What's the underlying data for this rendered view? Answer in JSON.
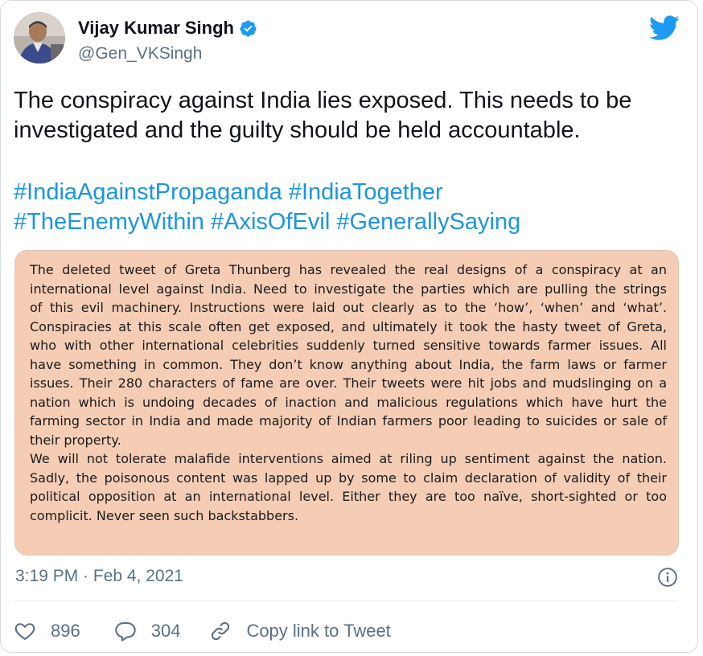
{
  "author": {
    "name": "Vijay Kumar Singh",
    "handle": "@Gen_VKSingh",
    "verified": true
  },
  "tweet": {
    "text_lines": [
      "The conspiracy against India lies exposed. This needs to be",
      "investigated and the guilty should be held accountable."
    ],
    "hashtag_lines": [
      [
        "#IndiaAgainstPropaganda",
        "#IndiaTogether"
      ],
      [
        "#TheEnemyWithin",
        "#AxisOfEvil",
        "#GenerallySaying"
      ]
    ],
    "image_text_lines": [
      "The deleted tweet of Greta Thunberg has revealed the real designs of a conspiracy at an",
      "international level against India. Need to investigate the parties which are pulling the strings",
      "of this evil machinery. Instructions were laid out clearly as to the ‘how’, ‘when’ and ‘what’.",
      "Conspiracies at this scale often get exposed, and ultimately it took the hasty tweet of Greta,",
      "who with other international celebrities suddenly turned sensitive towards farmer issues. All",
      "have something in common. They don’t know anything about India, the farm laws or farmer",
      "issues. Their 280 characters of fame are over. Their tweets were hit jobs and mudslinging on a",
      "nation which is undoing decades of inaction and malicious regulations which have hurt the",
      "farming sector in India and made majority of Indian farmers poor leading to suicides or sale of",
      "their property.",
      "We will not tolerate malafide interventions aimed at riling up sentiment against the nation.",
      "Sadly, the poisonous content was lapped up by some to claim declaration of validity of their",
      "political opposition at an international level. Either they are too naïve, short-sighted or too",
      "complicit. Never seen such backstabbers."
    ],
    "timestamp": "3:19 PM · Feb 4, 2021"
  },
  "actions": {
    "likes": "896",
    "replies": "304",
    "copy_link_label": "Copy link to Tweet"
  },
  "colors": {
    "link_blue": "#1b95e0",
    "image_background": "#f5cdb5",
    "secondary_text": "#5b7083"
  }
}
